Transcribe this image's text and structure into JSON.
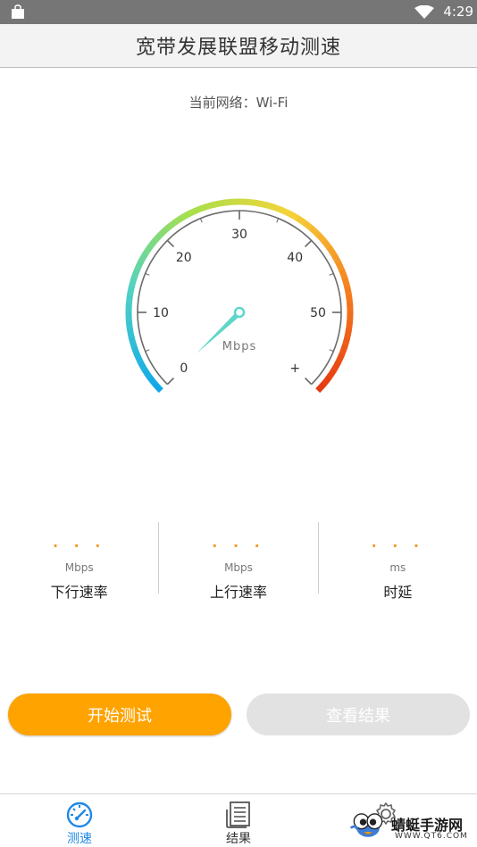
{
  "status_bar": {
    "time": "4:29",
    "icons": [
      "shopping-bag-icon",
      "wifi-icon",
      "battery-icon"
    ]
  },
  "app": {
    "title": "宽带发展联盟移动测速"
  },
  "network": {
    "label": "当前网络：Wi-Fi"
  },
  "gauge": {
    "tick_labels": [
      "0",
      "10",
      "20",
      "30",
      "40",
      "50",
      "+"
    ],
    "unit": "Mbps",
    "current_value": 0,
    "colors": [
      "#12a8e8",
      "#4fd1c5",
      "#a6e04b",
      "#f5d33a",
      "#f57c1f",
      "#e53b12"
    ],
    "needle_color": "#5ed6c8"
  },
  "stats": [
    {
      "value": "· · ·",
      "unit": "Mbps",
      "name": "下行速率"
    },
    {
      "value": "· · ·",
      "unit": "Mbps",
      "name": "上行速率"
    },
    {
      "value": "· · ·",
      "unit": "ms",
      "name": "时延"
    }
  ],
  "buttons": {
    "start": "开始测试",
    "view_results": "查看结果"
  },
  "bottom_nav": [
    {
      "label": "测速",
      "icon": "speedometer-icon",
      "active": true
    },
    {
      "label": "结果",
      "icon": "document-list-icon",
      "active": false
    },
    {
      "label": "",
      "icon": "settings-gear-icon",
      "active": false
    }
  ],
  "watermark": {
    "title": "蜻蜓手游网",
    "url": "WWW.QT6.COM"
  },
  "accent_colors": {
    "orange": "#ffa300",
    "blue": "#1e88e5",
    "gray_button": "#e2e2e2"
  }
}
